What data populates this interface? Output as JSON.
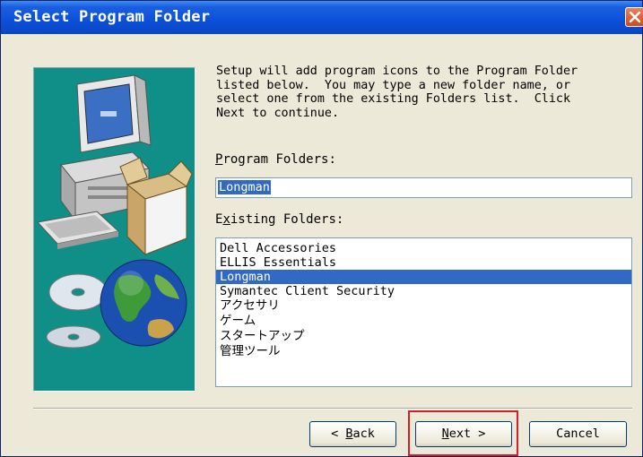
{
  "window": {
    "title": "Select Program Folder"
  },
  "description": {
    "lines": [
      "Setup will add program icons to the Program Folder",
      "listed below.  You may type a new folder name, or",
      "select one from the existing Folders list.  Click",
      "Next to continue."
    ]
  },
  "program_folders": {
    "label_accel": "P",
    "label_rest": "rogram Folders:",
    "value": "Longman"
  },
  "existing_folders": {
    "label_pre": "E",
    "label_accel": "x",
    "label_rest": "isting Folders:",
    "items": [
      "Dell Accessories",
      "ELLIS Essentials",
      "Longman",
      "Symantec Client Security",
      "アクセサリ",
      "ゲーム",
      "スタートアップ",
      "管理ツール"
    ],
    "selected": "Longman"
  },
  "buttons": {
    "back_pre": "< ",
    "back_accel": "B",
    "back_rest": "ack",
    "next_accel": "N",
    "next_rest": "ext >",
    "cancel": "Cancel"
  },
  "colors": {
    "titlebar": "#0a4fd8",
    "selection": "#316ac5",
    "panel": "#0f8f88",
    "highlight_box": "#d21f2b"
  },
  "icons": [
    "close-icon",
    "computer-illustration",
    "cd-disc-icon",
    "globe-icon"
  ]
}
